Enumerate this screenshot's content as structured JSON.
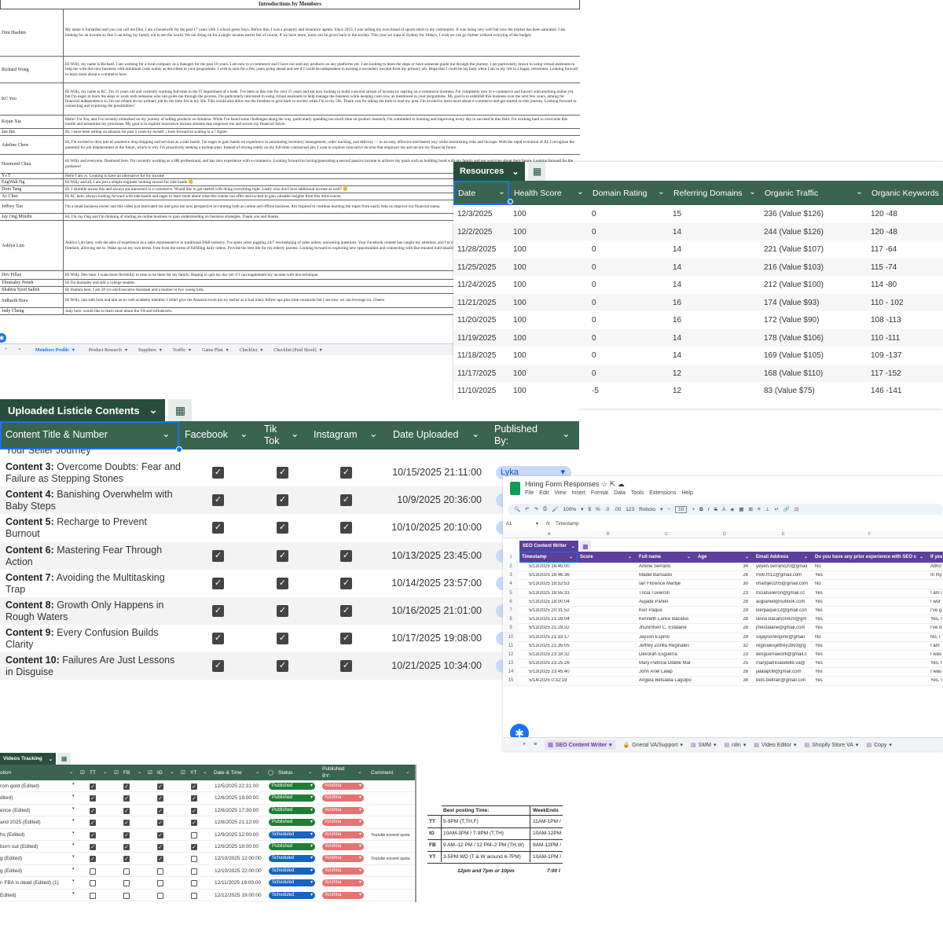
{
  "members": {
    "title": "Introductions by Members",
    "rows": [
      {
        "name": "Dini Hashim",
        "intro": "My name is Suhardini and you can call me Dini. I am a housewife for the past 17 years with 2 school goers boys. Before this, I was a property and insurance agents. Since 2013, I was selling my own brand of sports tshirt to my community. It was doing very well but now the market has been saturated. I am looking for an income so that I can bring my family out to see the world. We are doing ok for a single income earner but of course, if we have more, more can be given back to the society. This year we want to Sydney for 10days, I wish we can go further without worrying of the budget."
      },
      {
        "name": "Richard Wong",
        "intro": "Hi Willy, my name is Richard. I am working for a local company as a manager for the past 10 years. I am new to e-commerce and I have not sold any products on any platforms yet. I am looking to learn the steps or have someone guide me through the journey. I am particularly drawn to using virtual assistants to help me with this new business with minimum costs outlay as described in your programme. I wish to start for a few years going ahead and see if I could be independent in earning a secondary income from my primary job. Hope that I could be lay back when I am in my 50s in a happy retirement. Looking forward to learn more about e-commerce here."
      },
      {
        "name": "KC Yeo",
        "intro": "Hi Willy, my name is KC. I'm 41 years old and currently working full-time in the IT department of a bank. I've been in this role for over 15 years and am now looking to build a second stream of income by starting an e-commerce business. I'm completely new to e-commerce and haven't sold anything online yet, but I'm eager to learn the steps or work with someone who can guide me through the process. I'm particularly interested in using virtual assistants to help manage the business while keeping costs low, as mentioned in your programme. My goal is to establish this business over the next few years, aiming for financial independence so I'm not reliant on my primary job by the time I'm in my 50s. This would also allow me the freedom to give back to society when I'm in my 50s. Thank you for taking the time to read my post. I'm excited to learn more about e-commerce and get started on this journey. Looking forward to connecting and exploring the possibilities!"
      },
      {
        "name": "Kejun Xia",
        "intro": "Hello! I'm Xia, and I've recently embarked on my journey of selling products on Amazon. While I've faced some challenges along the way, particularly spending too much time on product research, I'm committed to learning and improving every day to succeed in this field. I'm working hard to overcome this hurdle and streamline my processes. My goal is to explore innovative income streams that empower me and secure my financial future."
      },
      {
        "name": "Jus Jus",
        "intro": "Hi, i have been selling on amazon for past 5 years by myself. i look forward to scaling to a 7 figure."
      },
      {
        "name": "Adeline Chew",
        "intro": "Hi, I'm excited to dive into eCommerce drop shipping and services as a side hustle. I'm eager to gain hands-on experience in automating inventory management, order tracking, and delivery — in an easy, effective and fastest way while minimizing risks and hiccups. With the rapid evolution of AI, I recognize the potential for job displacement in the future, which is why I'm proactively seeking a backup plan. Instead of relying solely on my full-time contractual job, I want to explore innovative income that empower me and secure my financial future."
      },
      {
        "name": "Desmond Chua",
        "intro": "Hi Willy and everyone, Desmond here. I'm currently working as a HR professional, and has zero experience with e-commerce. Looking forward to having/generating a second passive income to achieve my goals such as building bond with my family and not worrying about their future. Looking forward for the guidance!"
      },
      {
        "name": "Ys T",
        "intro": "Hello I am ys. Looking to have an alternative for my income"
      },
      {
        "name": "EngWah Ng",
        "intro": "Hi Willy and all, I am just a simple engineer looking around for side hustle 🙂"
      },
      {
        "name": "Dom Tang",
        "intro": "Hi. I stumble across this and always am interested in e-commerce. Would like to get started with doing everything right. Lastly who don't love additional income as well? 😊"
      },
      {
        "name": "Ac Chee",
        "intro": "Hi AC here, always looking forward with side hustle and eager to learn more about what this course can offer and excited to gain valuable insights from this mini-course."
      },
      {
        "name": "Jeffrey Tan",
        "intro": "I'm a small business owner and this video just motivated me and gave me new perspective on running both an online and offline business. Am inspired to continue learning the ropes from easily help us improve our financial status."
      },
      {
        "name": "Jay Ong Minzhi",
        "intro": "Hi, I'm Jay Ong and I'm thinking of starting an online business to gain understanding on business strategies. Thank you and thanks."
      },
      {
        "name": "Ashlyn Lim",
        "intro": "Ashlyn Lim here, with decades of experience as a sales representative in traditional F&B industry. I've spent years juggling 24/7 rescheduling of sales orders, answering questions. Your Facebook content has caught my attention, and I'm excited to learn more. My ultimate goal is to achieve time and financial freedom, allowing me to: Wake up on my own terms. Free from the stress of fulfilling daily orders. Provide the best life for my elderly parents. Looking forward to exploring new opportunities and connecting with like-minded individuals!"
      },
      {
        "name": "Dev Pillay",
        "intro": "Hi Willy. Dev here. I want more flexibility in time to be there for my family. Hoping to quit my day job if I can supplement my income with this technique."
      },
      {
        "name": "Thomaley Peneh",
        "intro": "Hi I'm thomaley and still a college student."
      },
      {
        "name": "Shahira Syed Salleh",
        "intro": "Hi Shahira here, I am 38 yrs old Executive Assistant and a mother to two young kids."
      },
      {
        "name": "Sidharth Bora",
        "intro": "Hi Willy, iam sidh bora and iam an ex web academy member. I didn't give the Amazon ecom biz try earlier as it had many follow ups plus time constraint but I see now we can leverage on. Cheers"
      },
      {
        "name": "Judy Cheng",
        "intro": "Judy here. would like to learn more about the VA and influencers."
      }
    ],
    "tabs": [
      "Members Profile",
      "Product Research",
      "Suppliers",
      "Traffic",
      "Game Plan",
      "Checklist",
      "Checklist (Paid Skool)"
    ]
  },
  "resources": {
    "tab_name": "Resources",
    "headers": [
      "Date",
      "Health Score",
      "Domain Rating",
      "Referring Domains",
      "Organic Traffic",
      "Organic Keywords"
    ],
    "rows": [
      [
        "12/3/2025",
        "100",
        "0",
        "15",
        "236 (Value $126)",
        "120 -48"
      ],
      [
        "12/2/2025",
        "100",
        "0",
        "14",
        "244 (Value $126)",
        "120 -48"
      ],
      [
        "11/28/2025",
        "100",
        "0",
        "14",
        "221 (Value $107)",
        "117 -64"
      ],
      [
        "11/25/2025",
        "100",
        "0",
        "14",
        "216 (Value $103)",
        "115 -74"
      ],
      [
        "11/24/2025",
        "100",
        "0",
        "14",
        "212 (Value $100)",
        "114 -80"
      ],
      [
        "11/21/2025",
        "100",
        "0",
        "16",
        "174 (Value $93)",
        "110 - 102"
      ],
      [
        "11/20/2025",
        "100",
        "0",
        "16",
        "172 (Value $90)",
        "108 -113"
      ],
      [
        "11/19/2025",
        "100",
        "0",
        "14",
        "178 (Value $106)",
        "110 -111"
      ],
      [
        "11/18/2025",
        "100",
        "0",
        "14",
        "169 (Value $105)",
        "109 -137"
      ],
      [
        "11/17/2025",
        "100",
        "0",
        "12",
        "168 (Value $110)",
        "117 -152"
      ],
      [
        "11/10/2025",
        "100",
        "-5",
        "12",
        "83 (Value $75)",
        "146 -141"
      ]
    ]
  },
  "listicle": {
    "tab_name": "Uploaded Listicle Contents",
    "headers": {
      "title": "Content Title & Number",
      "facebook": "Facebook",
      "tiktok_1": "Tik",
      "tiktok_2": "Tok",
      "instagram": "Instagram",
      "date": "Date Uploaded",
      "published_1": "Published",
      "published_2": "By:"
    },
    "partial_row": "Your Seller Journey",
    "rows": [
      {
        "num": "Content 3:",
        "title": "Overcome Doubts: Fear and Failure as Stepping Stones",
        "date": "10/15/2025 21:11:00",
        "by": "Lyka"
      },
      {
        "num": "Content 4:",
        "title": "Banishing Overwhelm with Baby Steps",
        "date": "10/9/2025 20:36:00",
        "by": ""
      },
      {
        "num": "Content 5:",
        "title": "Recharge to Prevent Burnout",
        "date": "10/10/2025 20:10:00",
        "by": ""
      },
      {
        "num": "Content 6:",
        "title": "Mastering Fear Through Action",
        "date": "10/13/2025 23:45:00",
        "by": ""
      },
      {
        "num": "Content 7:",
        "title": "Avoiding the Multitasking Trap",
        "date": "10/14/2025 23:57:00",
        "by": ""
      },
      {
        "num": "Content 8:",
        "title": "Growth Only Happens in Rough Waters",
        "date": "10/16/2025 21:01:00",
        "by": ""
      },
      {
        "num": "Content 9:",
        "title": " Every Confusion Builds Clarity",
        "date": "10/17/2025 19:08:00",
        "by": ""
      },
      {
        "num": "Content 10:",
        "title": "Failures Are Just Lessons in Disguise",
        "date": "10/21/2025 10:34:00",
        "by": ""
      }
    ]
  },
  "hiring": {
    "title": "Hiring Form Responses",
    "menu": [
      "File",
      "Edit",
      "View",
      "Insert",
      "Format",
      "Data",
      "Tools",
      "Extensions",
      "Help"
    ],
    "toolbar": {
      "zoom": "100%",
      "font": "Roboto",
      "size": "10"
    },
    "cell_ref": "A1",
    "formula": "Timestamp",
    "columns": [
      "A",
      "B",
      "C",
      "D",
      "E",
      "F"
    ],
    "tab_name": "SEO Content Writer",
    "headers": [
      "Timestamp",
      "Score",
      "Full name",
      "Age",
      "Email Address",
      "Do you have any prior experience with SEO c",
      "If yes"
    ],
    "rows": [
      {
        "n": "2",
        "ts": "5/13/2025 16:45:00",
        "name": "Arlene Serrano",
        "age": "34",
        "email": "yeyen.serrano20@gmail",
        "exp": "No",
        "extra": "Altho"
      },
      {
        "n": "3",
        "ts": "5/13/2025 16:46:36",
        "name": "Madel Barluado",
        "age": "26",
        "email": "mvb.fh12@gmail.com",
        "exp": "Yes",
        "extra": "In my"
      },
      {
        "n": "4",
        "ts": "5/13/2025 16:52:53",
        "name": "Ian Florence Martije",
        "age": "30",
        "email": "imartije0205@gmail.com",
        "exp": "No",
        "extra": ""
      },
      {
        "n": "5",
        "ts": "5/13/2025 16:55:33",
        "name": "Tricia Tuvieron",
        "age": "23",
        "email": "triciatuvieron@gmail.cc",
        "exp": "Yes",
        "extra": "I am l"
      },
      {
        "n": "6",
        "ts": "5/13/2025 18:00:04",
        "name": "Aujade Paniel",
        "age": "28",
        "email": "aujpaniel@outlook.com",
        "exp": "Yes",
        "extra": "I wor"
      },
      {
        "n": "7",
        "ts": "5/13/2025 20:31:52",
        "name": "Kier Paque",
        "age": "29",
        "email": "kierpaque12@gmail.con",
        "exp": "Yes",
        "extra": "I've g"
      },
      {
        "n": "8",
        "ts": "5/13/2025 21:28:04",
        "name": "Kenneth Lance Bacalso",
        "age": "28",
        "email": "lance.bacalso0420@gm",
        "exp": "Yes",
        "extra": "Yes, I"
      },
      {
        "n": "9",
        "ts": "5/13/2025 21:29:32",
        "name": "Jhunmherl C. Estalane",
        "age": "28",
        "email": "jmestalane@gmail.com",
        "exp": "Yes",
        "extra": "I've d"
      },
      {
        "n": "10",
        "ts": "5/13/2025 21:33:17",
        "name": "Jayson Espino",
        "age": "29",
        "email": "vajaysonespino@gmail.",
        "exp": "No",
        "extra": "No, I"
      },
      {
        "n": "11",
        "ts": "5/13/2025 21:35:05",
        "name": "Jeffrey Zorilla Reginales",
        "age": "32",
        "email": "reginalesjeffrey2893@g",
        "exp": "Yes",
        "extra": "I am"
      },
      {
        "n": "12",
        "ts": "5/13/2025 23:18:32",
        "name": "Devorah Esguerra",
        "age": "23",
        "email": "desguerrawork@gmail.c",
        "exp": "Yes",
        "extra": "I was"
      },
      {
        "n": "13",
        "ts": "5/13/2025 23:25:26",
        "name": "Mary Patricia Odelle Mar",
        "age": "25",
        "email": "marypatriciaodelle.va@",
        "exp": "Yes",
        "extra": "Yes, I"
      },
      {
        "n": "14",
        "ts": "5/13/2025 23:45:40",
        "name": "John Ariel Lalap",
        "age": "26",
        "email": "jalalap08@gmail.com",
        "exp": "Yes",
        "extra": "I was"
      },
      {
        "n": "15",
        "ts": "5/14/2025 0:32:19",
        "name": "Angela Betsaida Laguipo",
        "age": "38",
        "email": "bets.beltran@gmail.con",
        "exp": "Yes",
        "extra": "Yes, I"
      }
    ],
    "sheet_tabs": [
      "SEO Content Writer",
      "Gneral VA/Support",
      "SMM",
      "n8n",
      "Video Editor",
      "Shopify Store VA",
      "Copy"
    ]
  },
  "videos": {
    "tab_name": "Videos Tracking",
    "headers": {
      "title": "otion",
      "tt": "TT",
      "fb": "FB",
      "ig": "IG",
      "yt": "YT",
      "datetime": "Date & Time",
      "status": "Status",
      "published_1": "Published",
      "published_2": "BY:",
      "comment": "Comment"
    },
    "rows": [
      {
        "title": "rom gold (Edited)",
        "tt": true,
        "fb": true,
        "ig": true,
        "yt": true,
        "dt": "12/5/2025 22:31:00",
        "status": "Published",
        "by": "Krishna",
        "comment": ""
      },
      {
        "title": "dited)",
        "tt": true,
        "fb": true,
        "ig": true,
        "yt": true,
        "dt": "12/6/2025 19:00:00",
        "status": "Published",
        "by": "Krishna",
        "comment": ""
      },
      {
        "title": "ence (Edited)",
        "tt": true,
        "fb": true,
        "ig": true,
        "yt": true,
        "dt": "12/8/2025 17:30:00",
        "status": "Published",
        "by": "Krishna",
        "comment": ""
      },
      {
        "title": "and 2025 (Edited)",
        "tt": true,
        "fb": true,
        "ig": true,
        "yt": true,
        "dt": "12/8/2025 21:12:00",
        "status": "Published",
        "by": "Krishna",
        "comment": ""
      },
      {
        "title": "hs (Edited)",
        "tt": true,
        "fb": true,
        "ig": true,
        "yt": false,
        "dt": "12/9/2025 12:00:00",
        "status": "Scheduled",
        "by": "Krishna",
        "comment": "Youtube exceed quota"
      },
      {
        "title": "burn out (Edited)",
        "tt": true,
        "fb": true,
        "ig": true,
        "yt": true,
        "dt": "12/9/2025 18:00:00",
        "status": "Published",
        "by": "Krishna",
        "comment": ""
      },
      {
        "title": "g (Edited)",
        "tt": true,
        "fb": true,
        "ig": true,
        "yt": false,
        "dt": "12/10/2025 12:00:00",
        "status": "Scheduled",
        "by": "Krishna",
        "comment": "Youtube exceed quota"
      },
      {
        "title": "g (Edited)",
        "tt": false,
        "fb": false,
        "ig": false,
        "yt": false,
        "dt": "12/10/2025 22:00:00",
        "status": "Scheduled",
        "by": "Krishna",
        "comment": ""
      },
      {
        "title": "n FBA is dead (Edited) (1)",
        "tt": false,
        "fb": false,
        "ig": false,
        "yt": false,
        "dt": "12/11/2025 19:00:00",
        "status": "Scheduled",
        "by": "Krishna",
        "comment": ""
      },
      {
        "title": "Edited)",
        "tt": false,
        "fb": false,
        "ig": false,
        "yt": false,
        "dt": "12/12/2025 19:00:00",
        "status": "Scheduled",
        "by": "Krishna",
        "comment": ""
      }
    ],
    "best_posting": {
      "header": "Best posting Time:",
      "weekend_header": "WeekEnds",
      "rows": [
        {
          "platform": "TT",
          "time": "5-9PM (T,TH,F)",
          "weekend": "11AM-1PM /"
        },
        {
          "platform": "IG",
          "time": "10AM-3PM / 7-9PM (T,TH)",
          "weekend": "10AM-12PM"
        },
        {
          "platform": "FB",
          "time": "9 AM–12 PM / 12 PM–2 PM (TH,W)",
          "weekend": "9AM-12PM /"
        },
        {
          "platform": "YT",
          "time": "3-5PM WD (T & W around 6-7PM)",
          "weekend": "10AM-1PM /"
        }
      ],
      "footer": "12pm and 7pm or 10pm",
      "footer_weekend": "7:00 I"
    },
    "colors": {
      "published": "#1e7e34",
      "scheduled": "#1565c0",
      "krishna": "#e57373"
    }
  }
}
